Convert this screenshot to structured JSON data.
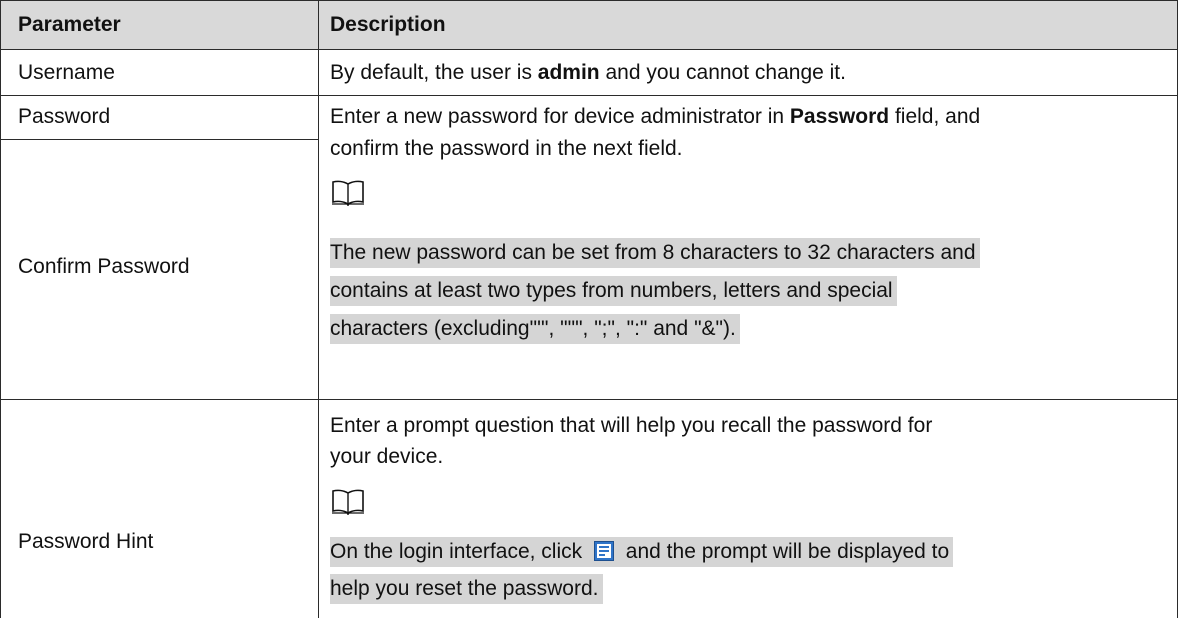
{
  "table": {
    "headers": {
      "parameter": "Parameter",
      "description": "Description"
    },
    "rows": {
      "username": {
        "param": "Username",
        "desc_before": "By default, the user is ",
        "desc_bold": "admin",
        "desc_after": " and you cannot change it."
      },
      "password": {
        "param": "Password",
        "confirm_param": "Confirm Password",
        "line1_before": "Enter a new password for device administrator in ",
        "line1_bold": "Password",
        "line1_after": " field, and",
        "line2": "confirm the password in the next field.",
        "note_icon": "book-note-icon",
        "note_line1": "The new password can be set from 8 characters to 32 characters and",
        "note_line2": "contains at least two types from numbers, letters and special",
        "note_line3": "characters (excluding\"'\", \"\"\", \";\", \":\" and \"&\")."
      },
      "hint": {
        "param": "Password Hint",
        "line1": "Enter a prompt question that will help you recall the password for",
        "line2": "your device.",
        "note_icon": "book-note-icon",
        "note_line1_before": "On the login interface, click ",
        "inline_icon": "password-hint-icon",
        "note_line1_after": " and the prompt will be displayed to",
        "note_line2": "help you reset the password."
      }
    }
  },
  "colors": {
    "header_bg": "#d9d9d9",
    "highlight": "#d5d5d5",
    "border": "#2b2b2b",
    "icon_blue": "#2f74c8"
  }
}
